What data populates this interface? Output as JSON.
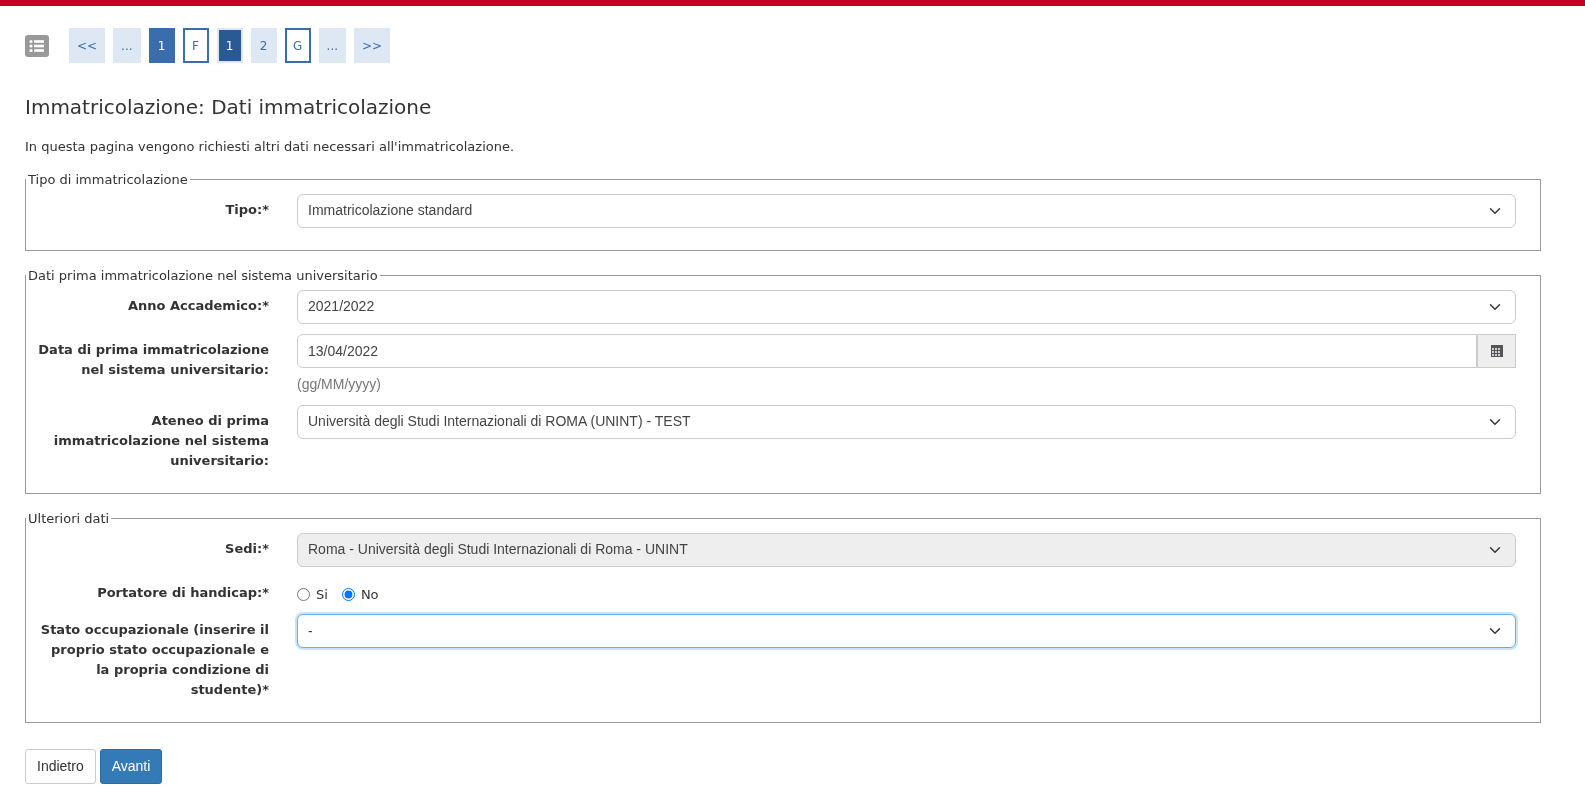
{
  "pager": [
    {
      "kind": "nav",
      "text": "<<"
    },
    {
      "kind": "nav",
      "text": "..."
    },
    {
      "kind": "done",
      "text": "1"
    },
    {
      "kind": "outlined",
      "text": "F"
    },
    {
      "kind": "current",
      "text": "1"
    },
    {
      "kind": "nav",
      "text": "2"
    },
    {
      "kind": "outlined",
      "text": "G"
    },
    {
      "kind": "nav",
      "text": "..."
    },
    {
      "kind": "nav",
      "text": ">>"
    }
  ],
  "title": "Immatricolazione: Dati immatricolazione",
  "intro": "In questa pagina vengono richiesti altri dati necessari all'immatricolazione.",
  "sections": [
    {
      "legend": "Tipo di immatricolazione",
      "fields": [
        {
          "kind": "select",
          "label": "Tipo:*",
          "value": "Immatricolazione standard",
          "disabled": false,
          "focused": false
        }
      ]
    },
    {
      "legend": "Dati prima immatricolazione nel sistema universitario",
      "fields": [
        {
          "kind": "select",
          "label": "Anno Accademico:*",
          "value": "2021/2022",
          "disabled": false,
          "focused": false
        },
        {
          "kind": "date",
          "label": "Data di prima immatricolazione nel sistema universitario:",
          "value": "13/04/2022",
          "hint": "(gg/MM/yyyy)"
        },
        {
          "kind": "select",
          "label": "Ateneo di prima immatricolazione nel sistema universitario:",
          "value": "Università degli Studi Internazionali di ROMA (UNINT) - TEST",
          "disabled": false,
          "focused": false
        }
      ]
    },
    {
      "legend": "Ulteriori dati",
      "fields": [
        {
          "kind": "select",
          "label": "Sedi:*",
          "value": "Roma - Università degli Studi Internazionali di Roma - UNINT",
          "disabled": true,
          "focused": false
        },
        {
          "kind": "radio",
          "label": "Portatore di handicap:*",
          "options": [
            {
              "text": "Si",
              "selected": false
            },
            {
              "text": "No",
              "selected": true
            }
          ]
        },
        {
          "kind": "select",
          "label": "Stato occupazionale (inserire il proprio stato occupazionale e la propria condizione di studente)*",
          "value": "-",
          "disabled": false,
          "focused": true
        }
      ]
    }
  ],
  "buttons": [
    {
      "kind": "secondary",
      "text": "Indietro"
    },
    {
      "kind": "primary",
      "text": "Avanti"
    }
  ]
}
